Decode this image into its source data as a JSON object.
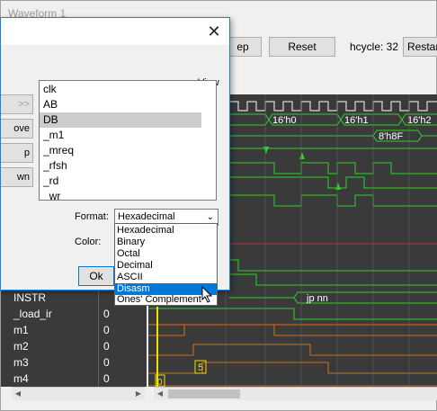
{
  "window": {
    "title": "Waveform 1"
  },
  "toolbar": {
    "step_label": "ep",
    "reset_label": "Reset",
    "hcycle_text": "hcycle: 32",
    "restart_label": "Restar"
  },
  "waveform": {
    "bus_labels": [
      "16'h0",
      "16'h1",
      "16'h2",
      "8'h8F"
    ],
    "instr_value": "jp nn",
    "marker_value": "5",
    "marker_value_2": "0"
  },
  "signals": [
    {
      "name": "INSTR",
      "value": ""
    },
    {
      "name": "_load_ir",
      "value": "0"
    },
    {
      "name": "m1",
      "value": "0"
    },
    {
      "name": "m2",
      "value": "0"
    },
    {
      "name": "m3",
      "value": "0"
    },
    {
      "name": "m4",
      "value": "0"
    }
  ],
  "dialog": {
    "view_label": "View",
    "list_items": [
      "clk",
      "AB",
      "DB",
      "_m1",
      "_mreq",
      "_rfsh",
      "_rd",
      "_wr"
    ],
    "selected_item": "DB",
    "side_buttons": [
      ">>",
      "ove",
      "p",
      "wn"
    ],
    "format_label": "Format:",
    "format_value": "Hexadecimal",
    "color_label": "Color:",
    "ok_label": "Ok"
  },
  "dropdown": {
    "options": [
      "Hexadecimal",
      "Binary",
      "Octal",
      "Decimal",
      "ASCII",
      "Disasm",
      "Ones' Complement"
    ],
    "highlighted": "Disasm"
  },
  "colors": {
    "wave_bg": "#3a3a3a",
    "signal_green": "#30d030",
    "signal_orange": "#d07020",
    "highlight": "#0078d7",
    "marker_yellow": "#f0e000"
  }
}
